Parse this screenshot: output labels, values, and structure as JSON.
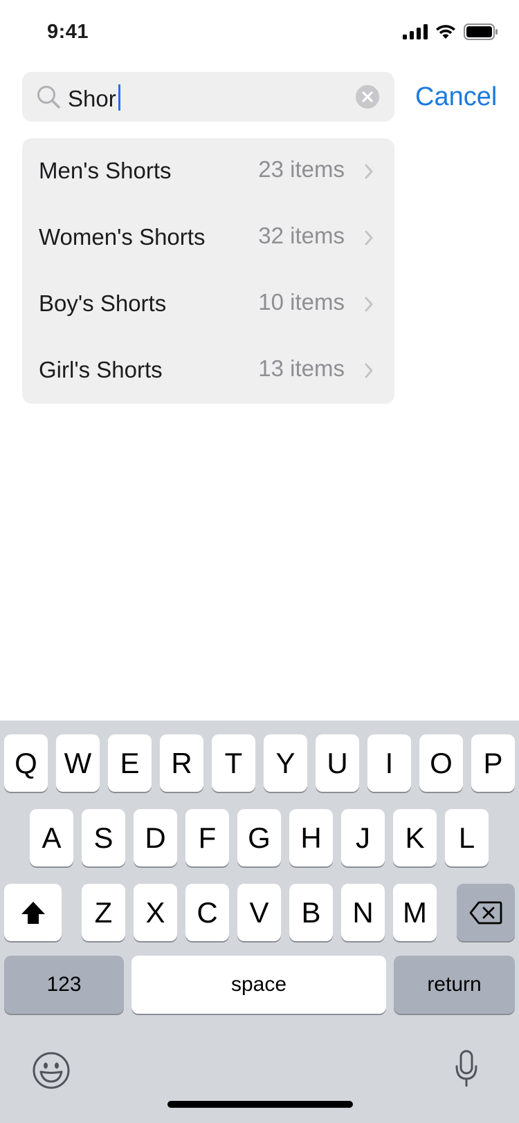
{
  "status_bar": {
    "time": "9:41",
    "icons": [
      "cellular-signal-icon",
      "wifi-icon",
      "battery-icon"
    ]
  },
  "search": {
    "value": "Shor",
    "cancel_label": "Cancel"
  },
  "results": [
    {
      "label": "Men's Shorts",
      "count": "23 items"
    },
    {
      "label": "Women's Shorts",
      "count": "32 items"
    },
    {
      "label": "Boy's Shorts",
      "count": "10 items"
    },
    {
      "label": "Girl's Shorts",
      "count": "13 items"
    }
  ],
  "keyboard": {
    "row1": [
      "Q",
      "W",
      "E",
      "R",
      "T",
      "Y",
      "U",
      "I",
      "O",
      "P"
    ],
    "row2": [
      "A",
      "S",
      "D",
      "F",
      "G",
      "H",
      "J",
      "K",
      "L"
    ],
    "row3": [
      "Z",
      "X",
      "C",
      "V",
      "B",
      "N",
      "M"
    ],
    "numbers_label": "123",
    "space_label": "space",
    "return_label": "return"
  },
  "colors": {
    "accent": "#1a7ae0",
    "caret": "#1a73e8",
    "secondary_text": "#8e8e93",
    "keyboard_bg": "#d3d6db"
  }
}
